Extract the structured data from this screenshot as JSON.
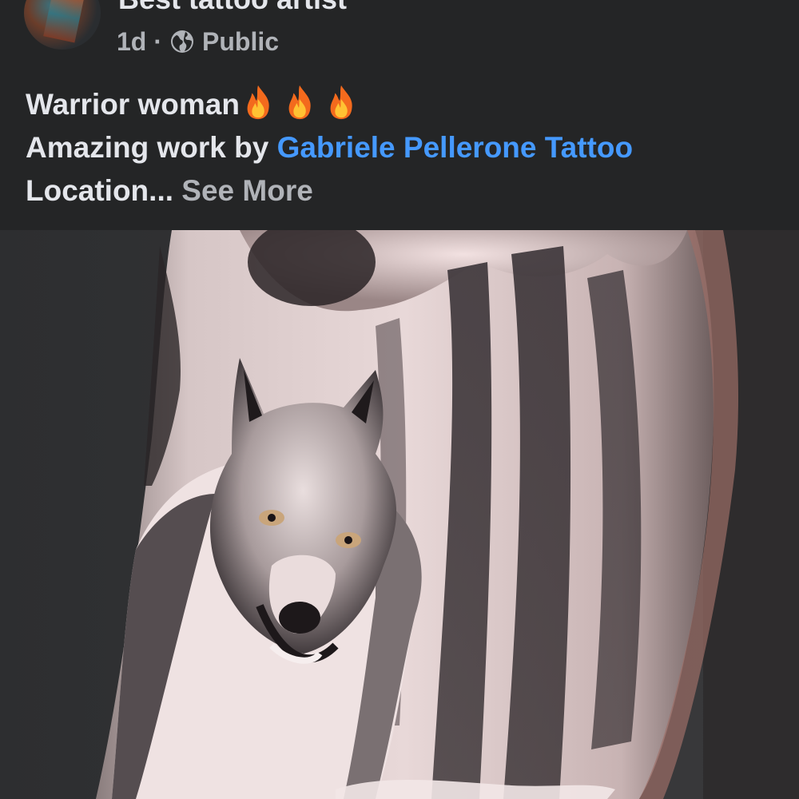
{
  "post": {
    "author_name": "Best tattoo artist",
    "time_ago": "1d",
    "separator": "·",
    "audience": "Public",
    "audience_icon": "globe-icon",
    "caption": {
      "line1_text": "Warrior woman",
      "line1_emoji": [
        "fire-icon",
        "fire-icon",
        "fire-icon"
      ],
      "line2_prefix": "Amazing work by ",
      "line2_mention": "Gabriele Pellerone Tattoo",
      "line3_text": "Location...",
      "see_more": "See More"
    },
    "colors": {
      "background": "#242526",
      "text_primary": "#e4e6eb",
      "text_secondary": "#b0b3b8",
      "link": "#4599ff"
    }
  }
}
